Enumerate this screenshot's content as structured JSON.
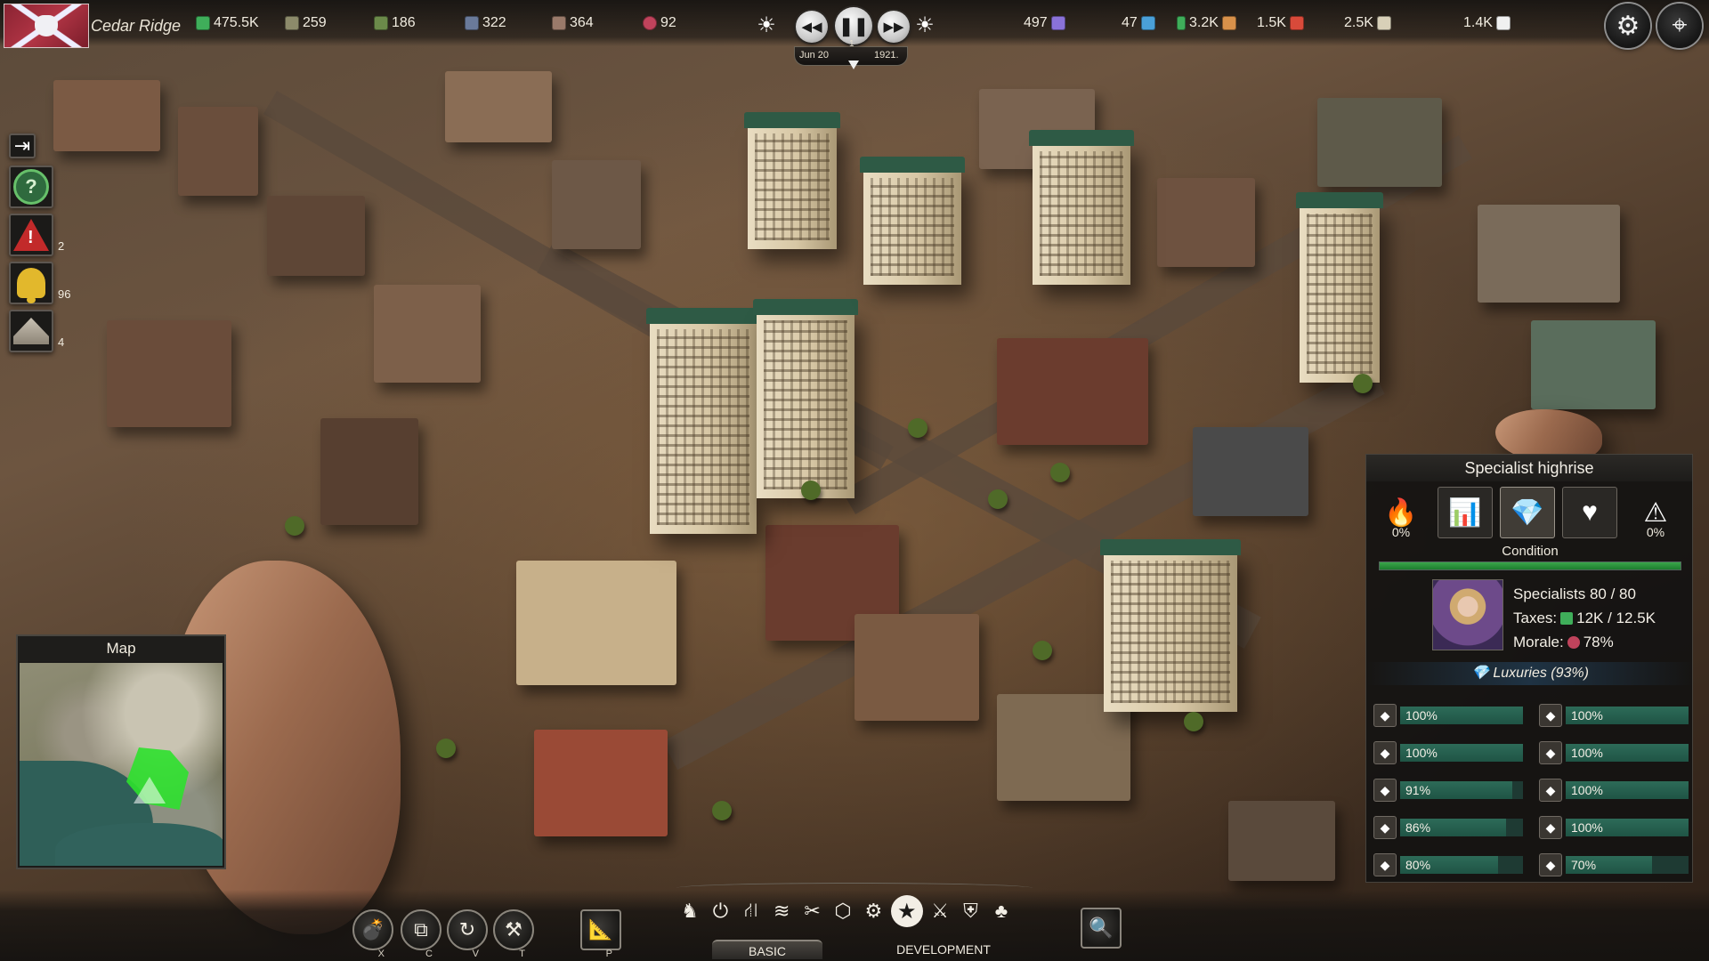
{
  "header": {
    "city_name": "Cedar Ridge",
    "stats_left": [
      {
        "value": "475.5K",
        "icon": "money-icon",
        "color": "#3fae5a"
      },
      {
        "value": "259",
        "icon": "workers-icon",
        "color": "#8c8a6a"
      },
      {
        "value": "186",
        "icon": "farmers-icon",
        "color": "#6b8a4a"
      },
      {
        "value": "322",
        "icon": "engineers-icon",
        "color": "#6a7a9a"
      },
      {
        "value": "364",
        "icon": "specialists-icon",
        "color": "#9a7a6a"
      },
      {
        "value": "92",
        "icon": "morale-icon",
        "color": "#c0435c"
      }
    ],
    "stats_right": [
      {
        "value": "497",
        "icon": "power-icon",
        "color": "#8a72d8"
      },
      {
        "value": "47",
        "icon": "water-icon",
        "color": "#4aa0d8"
      },
      {
        "value": "3.2K",
        "icon": "food-icon",
        "color": "#d8914a"
      },
      {
        "value": "1.5K",
        "icon": "goods-icon",
        "color": "#d84a3a"
      },
      {
        "value": "2.5K",
        "icon": "materials-icon",
        "color": "#d8d0b8"
      },
      {
        "value": "1.4K",
        "icon": "paper-icon",
        "color": "#f0f0f0"
      }
    ],
    "time": {
      "date": "Jun 20",
      "year": "1921.",
      "speed": "1"
    }
  },
  "left_notifications": [
    {
      "name": "exit-button",
      "badge": ""
    },
    {
      "name": "help-button",
      "badge": ""
    },
    {
      "name": "alerts-button",
      "badge": "2"
    },
    {
      "name": "notifications-button",
      "badge": "96"
    },
    {
      "name": "events-button",
      "badge": "4"
    }
  ],
  "minimap": {
    "title": "Map"
  },
  "panel": {
    "title": "Specialist highrise",
    "tabs": [
      {
        "icon": "fire-risk-icon",
        "pct": "0%"
      },
      {
        "icon": "statistics-icon",
        "pct": ""
      },
      {
        "icon": "luxuries-icon",
        "pct": ""
      },
      {
        "icon": "health-icon",
        "pct": ""
      },
      {
        "icon": "crime-icon",
        "pct": "0%"
      }
    ],
    "condition_label": "Condition",
    "condition_fill": 1.0,
    "specialists": "Specialists 80 / 80",
    "taxes_label": "Taxes:",
    "taxes_value": "12K / 12.5K",
    "morale_label": "Morale:",
    "morale_value": "78%",
    "luxuries_title": "Luxuries (93%)",
    "luxuries": [
      {
        "icon": "clothing-icon",
        "value": "100%",
        "fill": 1.0
      },
      {
        "icon": "cigar-icon",
        "value": "100%",
        "fill": 1.0
      },
      {
        "icon": "radio-icon",
        "value": "100%",
        "fill": 1.0
      },
      {
        "icon": "beer-icon",
        "value": "100%",
        "fill": 1.0
      },
      {
        "icon": "canned-food-icon",
        "value": "91%",
        "fill": 0.91
      },
      {
        "icon": "appliances-icon",
        "value": "100%",
        "fill": 1.0
      },
      {
        "icon": "fashion-icon",
        "value": "86%",
        "fill": 0.86
      },
      {
        "icon": "wine-icon",
        "value": "100%",
        "fill": 1.0
      },
      {
        "icon": "jewelry-icon",
        "value": "80%",
        "fill": 0.8
      },
      {
        "icon": "books-icon",
        "value": "70%",
        "fill": 0.7
      }
    ]
  },
  "toolbar": {
    "tools": [
      {
        "name": "demolish-tool",
        "key": "X"
      },
      {
        "name": "copy-tool",
        "key": "C"
      },
      {
        "name": "rotate-tool",
        "key": "V"
      },
      {
        "name": "upgrade-tool",
        "key": "T"
      },
      {
        "name": "plan-tool",
        "key": "P"
      }
    ],
    "mode_basic": "BASIC",
    "mode_development": "DEVELOPMENT"
  }
}
